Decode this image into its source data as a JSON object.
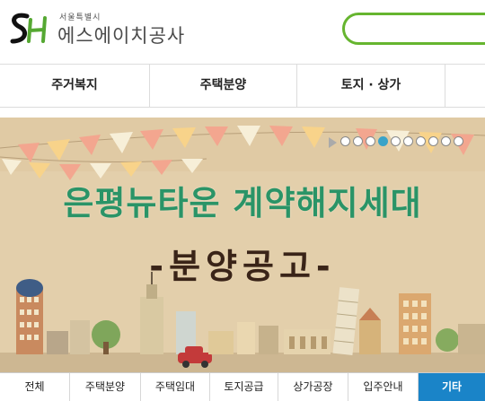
{
  "header": {
    "org_subtitle": "서울특별시",
    "org_name": "에스에이치공사",
    "search": {
      "value": "",
      "placeholder": ""
    }
  },
  "nav": {
    "items": [
      {
        "label": "주거복지"
      },
      {
        "label": "주택분양"
      },
      {
        "label": "토지 · 상가"
      }
    ]
  },
  "banner": {
    "title": "은평뉴타운 계약해지세대",
    "subtitle": "-분양공고-",
    "slider": {
      "total": 10,
      "active_index": 3
    }
  },
  "tabs": {
    "items": [
      {
        "label": "전체"
      },
      {
        "label": "주택분양"
      },
      {
        "label": "주택임대"
      },
      {
        "label": "토지공급"
      },
      {
        "label": "상가공장"
      },
      {
        "label": "입주안내"
      },
      {
        "label": "기타"
      }
    ],
    "active_index": 6
  },
  "colors": {
    "brand_green": "#66b52f",
    "title_green": "#2a9467",
    "active_tab_blue": "#1a84c8",
    "banner_bg": "#e3cfab"
  }
}
